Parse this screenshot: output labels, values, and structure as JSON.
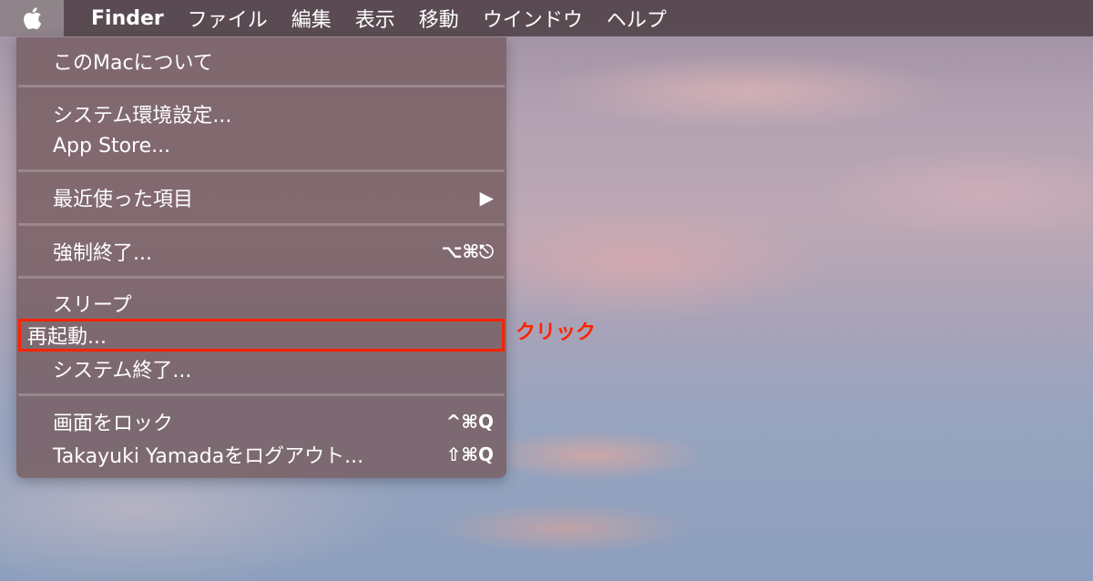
{
  "menubar": {
    "apple_icon": "apple-logo-icon",
    "app_name": "Finder",
    "items": [
      "ファイル",
      "編集",
      "表示",
      "移動",
      "ウインドウ",
      "ヘルプ"
    ]
  },
  "apple_menu": {
    "about": "このMacについて",
    "preferences": "システム環境設定...",
    "app_store": "App Store...",
    "recent_items": "最近使った項目",
    "recent_items_arrow": "▶",
    "force_quit": "強制終了...",
    "force_quit_shortcut": "⌥⌘⎋",
    "sleep": "スリープ",
    "restart": "再起動...",
    "shutdown": "システム終了...",
    "lock_screen": "画面をロック",
    "lock_screen_shortcut": "^⌘Q",
    "logout": "Takayuki Yamadaをログアウト...",
    "logout_shortcut": "⇧⌘Q"
  },
  "annotation": {
    "callout": "クリック",
    "color": "#ff2200"
  }
}
